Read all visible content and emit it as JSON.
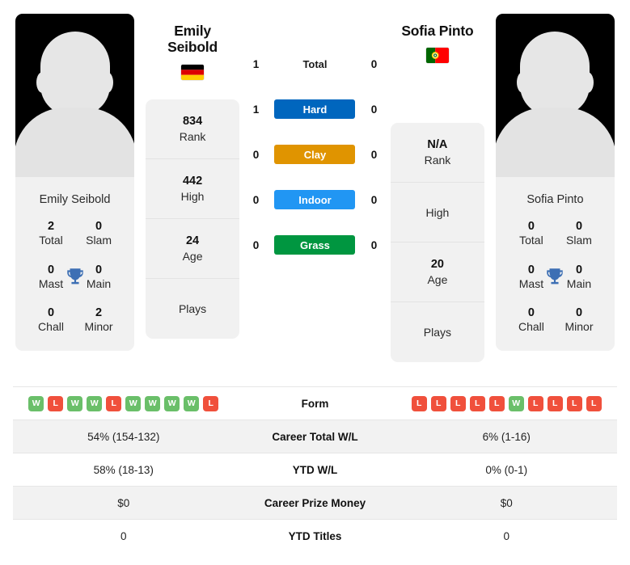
{
  "players": {
    "left": {
      "name": "Emily Seibold",
      "title_line1": "Emily",
      "title_line2": "Seibold",
      "photo_caption": "Emily Seibold",
      "flag": "germany-flag",
      "titles": {
        "total_value": "2",
        "total_label": "Total",
        "slam_value": "0",
        "slam_label": "Slam",
        "mast_value": "0",
        "mast_label": "Mast",
        "main_value": "0",
        "main_label": "Main",
        "chall_value": "0",
        "chall_label": "Chall",
        "minor_value": "2",
        "minor_label": "Minor"
      },
      "info": [
        {
          "value": "834",
          "key": "Rank"
        },
        {
          "value": "442",
          "key": "High"
        },
        {
          "value": "24",
          "key": "Age"
        },
        {
          "value": "",
          "key": "Plays"
        }
      ],
      "form": [
        "W",
        "L",
        "W",
        "W",
        "L",
        "W",
        "W",
        "W",
        "W",
        "L"
      ],
      "career_total_wl": "54% (154-132)",
      "ytd_wl": "58% (18-13)",
      "career_prize_money": "$0",
      "ytd_titles": "0"
    },
    "right": {
      "name": "Sofia Pinto",
      "title_line1": "Sofia Pinto",
      "title_line2": "",
      "photo_caption": "Sofia Pinto",
      "flag": "portugal-flag",
      "titles": {
        "total_value": "0",
        "total_label": "Total",
        "slam_value": "0",
        "slam_label": "Slam",
        "mast_value": "0",
        "mast_label": "Mast",
        "main_value": "0",
        "main_label": "Main",
        "chall_value": "0",
        "chall_label": "Chall",
        "minor_value": "0",
        "minor_label": "Minor"
      },
      "info": [
        {
          "value": "N/A",
          "key": "Rank"
        },
        {
          "value": "",
          "key": "High"
        },
        {
          "value": "20",
          "key": "Age"
        },
        {
          "value": "",
          "key": "Plays"
        }
      ],
      "form": [
        "L",
        "L",
        "L",
        "L",
        "L",
        "W",
        "L",
        "L",
        "L",
        "L"
      ],
      "career_total_wl": "6% (1-16)",
      "ytd_wl": "0% (0-1)",
      "career_prize_money": "$0",
      "ytd_titles": "0"
    }
  },
  "surfaces": [
    {
      "label": "Total",
      "left": "1",
      "right": "0",
      "color": "none",
      "style": "plain"
    },
    {
      "label": "Hard",
      "left": "1",
      "right": "0",
      "color": "#0066be",
      "style": "pill"
    },
    {
      "label": "Clay",
      "left": "0",
      "right": "0",
      "color": "#e09400",
      "style": "pill"
    },
    {
      "label": "Indoor",
      "left": "0",
      "right": "0",
      "color": "#2196f3",
      "style": "pill"
    },
    {
      "label": "Grass",
      "left": "0",
      "right": "0",
      "color": "#009640",
      "style": "pill"
    }
  ],
  "table_rows": [
    {
      "label": "Form",
      "type": "form"
    },
    {
      "label": "Career Total W/L",
      "type": "text",
      "key": "career_total_wl"
    },
    {
      "label": "YTD W/L",
      "type": "text",
      "key": "ytd_wl"
    },
    {
      "label": "Career Prize Money",
      "type": "text",
      "key": "career_prize_money"
    },
    {
      "label": "YTD Titles",
      "type": "text",
      "key": "ytd_titles"
    }
  ],
  "colors": {
    "win_badge": "#6abf69",
    "loss_badge": "#f0503c",
    "trophy": "#3d6fb4",
    "card_bg": "#f1f1f1",
    "row_alt": "#f2f2f2"
  }
}
